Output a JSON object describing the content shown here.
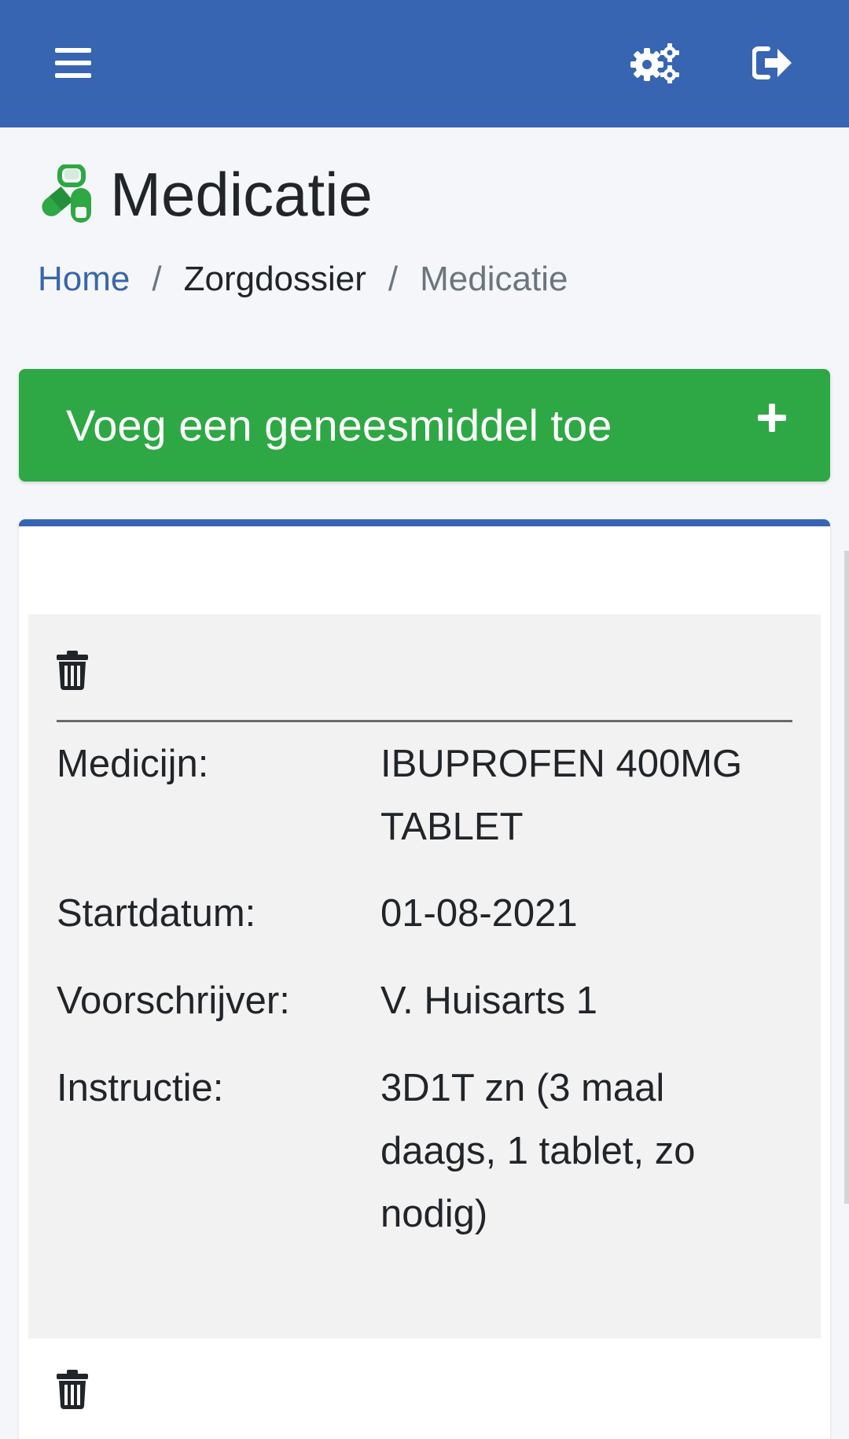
{
  "header": {
    "menu_icon": "hamburger-menu-icon",
    "settings_icon": "gears-icon",
    "logout_icon": "sign-out-icon",
    "color": "#3765b2"
  },
  "page": {
    "title": "Medicatie",
    "title_icon": "pills-icon",
    "title_icon_color": "#2ea844"
  },
  "breadcrumb": {
    "items": [
      "Home",
      "Zorgdossier",
      "Medicatie"
    ],
    "separator": "/"
  },
  "add_button": {
    "label": "Voeg een geneesmiddel toe",
    "icon": "plus-icon",
    "color": "#2ea844"
  },
  "medications": [
    {
      "delete_icon": "trash-icon",
      "fields": [
        {
          "label": "Medicijn:",
          "value": "IBUPROFEN 400MG TABLET"
        },
        {
          "label": "Startdatum:",
          "value": "01-08-2021"
        },
        {
          "label": "Voorschrijver:",
          "value": "V. Huisarts 1"
        },
        {
          "label": "Instructie:",
          "value": "3D1T zn (3 maal daags, 1 tablet, zo nodig)"
        }
      ]
    },
    {
      "delete_icon": "trash-icon"
    }
  ]
}
